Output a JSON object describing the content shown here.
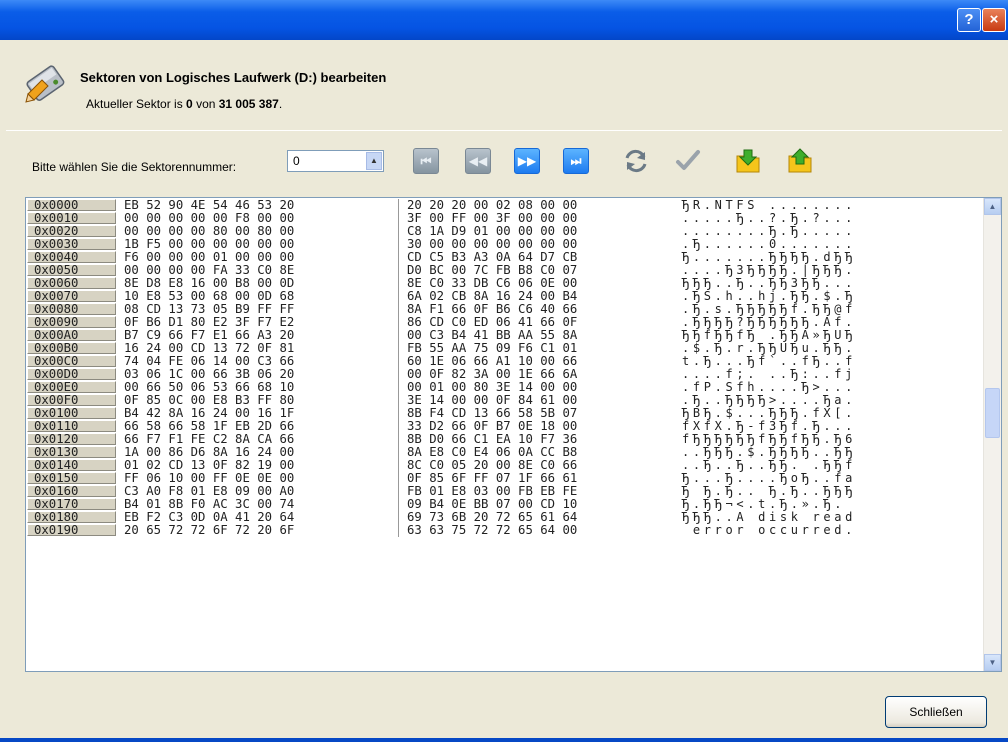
{
  "window": {
    "help_label": "?",
    "close_label": "×",
    "title": "Sektoren von Logisches Laufwerk (D:) bearbeiten",
    "icon": "drive-pencil-icon"
  },
  "status": {
    "prefix": "Aktueller Sektor is ",
    "current": "0",
    "middle": " von ",
    "total": "31 005 387",
    "suffix": "."
  },
  "sector_selector": {
    "label": "Bitte wählen Sie die Sektorennummer:",
    "value": "0",
    "up_arrow": "▲"
  },
  "toolbar": {
    "first": "⏮",
    "prev": "◀◀",
    "next": "▶▶",
    "last": "⏭",
    "icons": [
      "first-sector-icon",
      "previous-sector-icon",
      "next-sector-icon",
      "last-sector-icon",
      "undo-refresh-icon",
      "apply-check-icon",
      "load-folder-icon",
      "save-folder-icon"
    ]
  },
  "hex_view": {
    "rows": [
      {
        "addr": "0x0000",
        "h1": "EB 52 90 4E 54 46 53 20",
        "h2": "20 20 20 00 02 08 00 00",
        "ascii": "ЂR.NTFS ........"
      },
      {
        "addr": "0x0010",
        "h1": "00 00 00 00 00 F8 00 00",
        "h2": "3F 00 FF 00 3F 00 00 00",
        "ascii": ".....Ђ..?.Ђ.?..."
      },
      {
        "addr": "0x0020",
        "h1": "00 00 00 00 80 00 80 00",
        "h2": "C8 1A D9 01 00 00 00 00",
        "ascii": "........Ђ.Ђ....."
      },
      {
        "addr": "0x0030",
        "h1": "1B F5 00 00 00 00 00 00",
        "h2": "30 00 00 00 00 00 00 00",
        "ascii": ".Ђ......0......."
      },
      {
        "addr": "0x0040",
        "h1": "F6 00 00 00 01 00 00 00",
        "h2": "CD C5 B3 A3 0A 64 D7 CB",
        "ascii": "Ђ.......ЂЂЂЂ.dЂЂ"
      },
      {
        "addr": "0x0050",
        "h1": "00 00 00 00 FA 33 C0 8E",
        "h2": "D0 BC 00 7C FB B8 C0 07",
        "ascii": "....Ђ3ЂЂЂЂ.|ЂЂЂ."
      },
      {
        "addr": "0x0060",
        "h1": "8E D8 E8 16 00 B8 00 0D",
        "h2": "8E C0 33 DB C6 06 0E 00",
        "ascii": "ЂЂЂ..Ђ..ЂЂ3ЂЂ..."
      },
      {
        "addr": "0x0070",
        "h1": "10 E8 53 00 68 00 0D 68",
        "h2": "6A 02 CB 8A 16 24 00 B4",
        "ascii": ".ЂS.h..hj.ЂЂ.$.Ђ"
      },
      {
        "addr": "0x0080",
        "h1": "08 CD 13 73 05 B9 FF FF",
        "h2": "8A F1 66 0F B6 C6 40 66",
        "ascii": ".Ђ.s.ЂЂЂЂЂf.ЂЂ@f"
      },
      {
        "addr": "0x0090",
        "h1": "0F B6 D1 80 E2 3F F7 E2",
        "h2": "86 CD C0 ED 06 41 66 0F",
        "ascii": ".ЂЂЂЂ?ЂЂЂЂЂЂ.Af."
      },
      {
        "addr": "0x00A0",
        "h1": "B7 C9 66 F7 E1 66 A3 20",
        "h2": "00 C3 B4 41 BB AA 55 8A",
        "ascii": "ЂЂfЂЂfЂ .ЂЂA»ЂUЂ"
      },
      {
        "addr": "0x00B0",
        "h1": "16 24 00 CD 13 72 0F 81",
        "h2": "FB 55 AA 75 09 F6 C1 01",
        "ascii": ".$.Ђ.r.ЂЂUЂu.ЂЂ."
      },
      {
        "addr": "0x00C0",
        "h1": "74 04 FE 06 14 00 C3 66",
        "h2": "60 1E 06 66 A1 10 00 66",
        "ascii": "t.Ђ...Ђf`..fЂ..f"
      },
      {
        "addr": "0x00D0",
        "h1": "03 06 1C 00 66 3B 06 20",
        "h2": "00 0F 82 3A 00 1E 66 6A",
        "ascii": "....f;. ..Ђ:..fj"
      },
      {
        "addr": "0x00E0",
        "h1": "00 66 50 06 53 66 68 10",
        "h2": "00 01 00 80 3E 14 00 00",
        "ascii": ".fP.Sfh....Ђ>..."
      },
      {
        "addr": "0x00F0",
        "h1": "0F 85 0C 00 E8 B3 FF 80",
        "h2": "3E 14 00 00 0F 84 61 00",
        "ascii": ".Ђ..ЂЂЂЂ>....Ђa."
      },
      {
        "addr": "0x0100",
        "h1": "B4 42 8A 16 24 00 16 1F",
        "h2": "8B F4 CD 13 66 58 5B 07",
        "ascii": "ЂBЂ.$...ЂЂЂ.fX[."
      },
      {
        "addr": "0x0110",
        "h1": "66 58 66 58 1F EB 2D 66",
        "h2": "33 D2 66 0F B7 0E 18 00",
        "ascii": "fXfX.Ђ-f3Ђf.Ђ..."
      },
      {
        "addr": "0x0120",
        "h1": "66 F7 F1 FE C2 8A CA 66",
        "h2": "8B D0 66 C1 EA 10 F7 36",
        "ascii": "fЂЂЂЂЂЂfЂЂfЂЂ.Ђ6"
      },
      {
        "addr": "0x0130",
        "h1": "1A 00 86 D6 8A 16 24 00",
        "h2": "8A E8 C0 E4 06 0A CC B8",
        "ascii": "..ЂЂЂ.$.ЂЂЂЂ..ЂЂ"
      },
      {
        "addr": "0x0140",
        "h1": "01 02 CD 13 0F 82 19 00",
        "h2": "8C C0 05 20 00 8E C0 66",
        "ascii": "..Ђ..Ђ..ЂЂ. .ЂЂf"
      },
      {
        "addr": "0x0150",
        "h1": "FF 06 10 00 FF 0E 0E 00",
        "h2": "0F 85 6F FF 07 1F 66 61",
        "ascii": "Ђ...Ђ....ЂoЂ..fa"
      },
      {
        "addr": "0x0160",
        "h1": "C3 A0 F8 01 E8 09 00 A0",
        "h2": "FB 01 E8 03 00 FB EB FE",
        "ascii": "Ђ Ђ.Ђ.. Ђ.Ђ..ЂЂЂ"
      },
      {
        "addr": "0x0170",
        "h1": "B4 01 8B F0 AC 3C 00 74",
        "h2": "09 B4 0E BB 07 00 CD 10",
        "ascii": "Ђ.ЂЂ¬<.t.Ђ.».Ђ."
      },
      {
        "addr": "0x0180",
        "h1": "EB F2 C3 0D 0A 41 20 64",
        "h2": "69 73 6B 20 72 65 61 64",
        "ascii": "ЂЂЂ..A disk read"
      },
      {
        "addr": "0x0190",
        "h1": "20 65 72 72 6F 72 20 6F",
        "h2": "63 63 75 72 72 65 64 00",
        "ascii": " error occurred."
      }
    ]
  },
  "footer": {
    "close_button": "Schließen"
  }
}
